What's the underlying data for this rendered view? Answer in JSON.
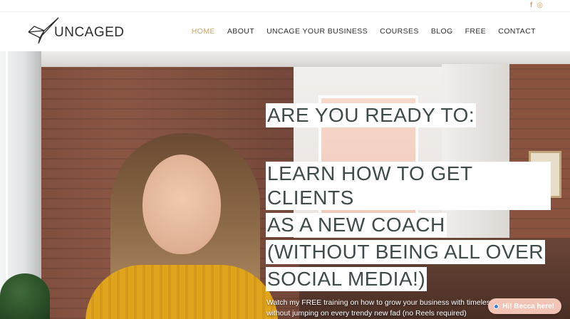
{
  "topbar": {
    "social_icons": [
      "facebook-icon",
      "instagram-icon"
    ],
    "facebook_glyph": "f",
    "instagram_glyph": "◎"
  },
  "brand": {
    "name": "UNCAGED",
    "logo_icon": "origami-bird-icon"
  },
  "nav": {
    "items": [
      {
        "label": "HOME",
        "active": true
      },
      {
        "label": "ABOUT",
        "active": false
      },
      {
        "label": "UNCAGE YOUR BUSINESS",
        "active": false
      },
      {
        "label": "COURSES",
        "active": false
      },
      {
        "label": "BLOG",
        "active": false
      },
      {
        "label": "FREE",
        "active": false
      },
      {
        "label": "CONTACT",
        "active": false
      }
    ]
  },
  "hero": {
    "headline_lines": [
      "ARE YOU READY TO:",
      "LEARN HOW TO GET CLIENTS",
      "AS A NEW COACH",
      "(WITHOUT BEING ALL OVER",
      "SOCIAL MEDIA!)"
    ],
    "subtext_line1": "Watch my FREE training on how to grow your business with timeless marke",
    "subtext_line2": "without jumping on every trendy new fad (no Reels required)"
  },
  "chat_widget": {
    "label": "Hi! Becca here!"
  },
  "colors": {
    "accent": "#c9a66b",
    "nav_text": "#2f2f2f",
    "headline_text": "#3f4b4a",
    "chat_bg": "#f1c4b6"
  }
}
